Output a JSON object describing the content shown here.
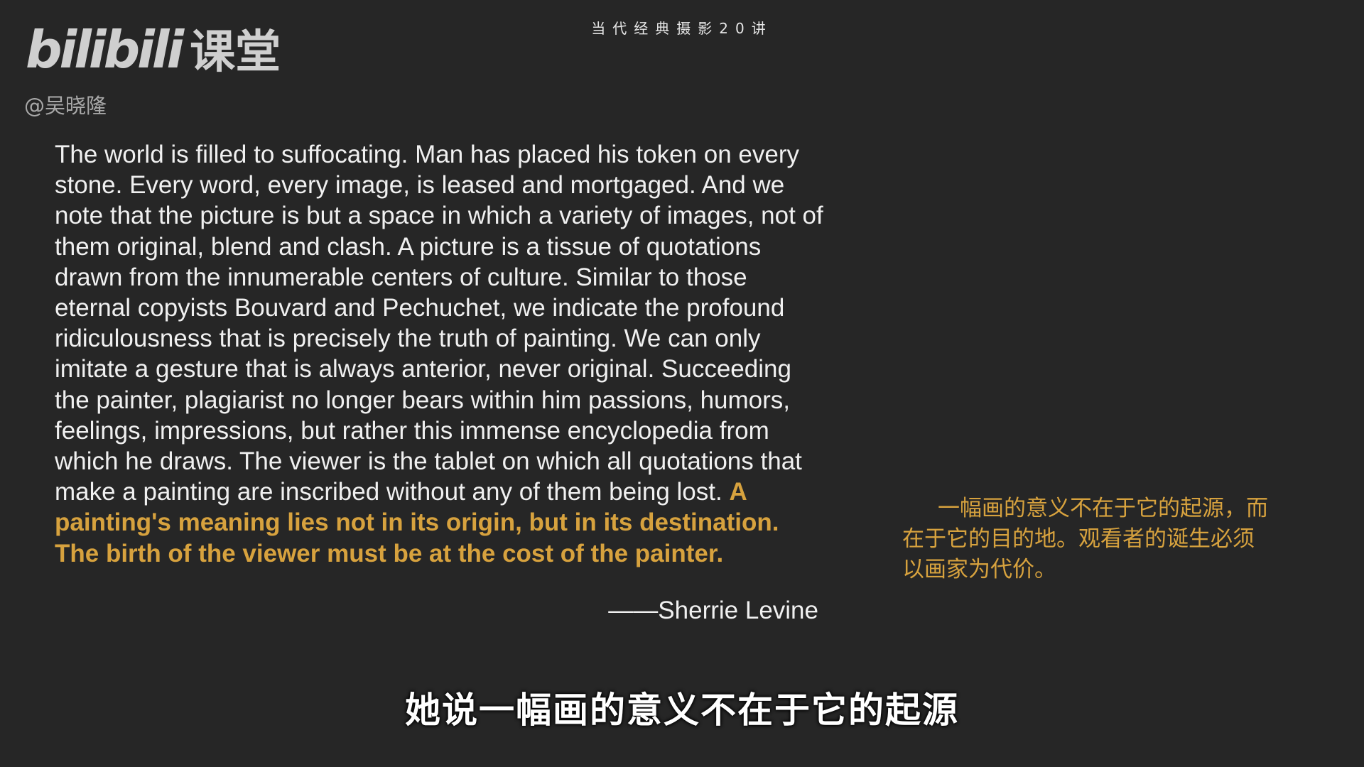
{
  "watermark": {
    "logo_mark": "bilibili",
    "logo_text": "课堂",
    "author": "@吴晓隆"
  },
  "series_title": "当代经典摄影20讲",
  "quote": {
    "body": "The world is filled to suffocating. Man has placed his token on every stone. Every word, every image, is leased and mortgaged. And we note that the picture is but a space in which a variety of images, not of them original, blend and clash. A picture is a tissue of quotations drawn from the innumerable centers of culture. Similar to those eternal copyists Bouvard and Pechuchet, we indicate the profound ridiculousness that is precisely the truth of painting. We can only imitate a gesture that is always anterior, never original. Succeeding the painter, plagiarist no longer bears within him passions, humors, feelings, impressions, but rather this immense encyclopedia from which he draws. The viewer is the tablet on which all quotations that make a painting are inscribed without any of them being lost. ",
    "highlight": "A painting's meaning lies not in its origin, but in its destination. The birth of the viewer must be at the cost of the painter.",
    "attribution": "——Sherrie Levine"
  },
  "translation": "一幅画的意义不在于它的起源，而在于它的目的地。观看者的诞生必须以画家为代价。",
  "subtitle": "她说一幅画的意义不在于它的起源",
  "colors": {
    "background": "#262626",
    "text": "#f0f0f0",
    "accent": "#d7a23e"
  }
}
